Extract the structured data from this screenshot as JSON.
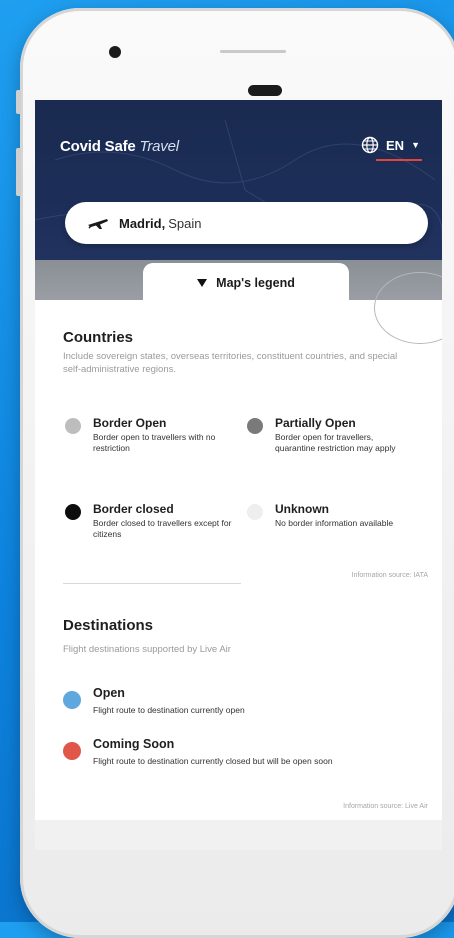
{
  "app": {
    "brand_bold": "Covid Safe",
    "brand_light": "Travel",
    "language": "EN",
    "language_caret": "▼"
  },
  "search": {
    "city": "Madrid,",
    "country": "Spain"
  },
  "legend_tab": {
    "label": "Map's legend"
  },
  "countries": {
    "title": "Countries",
    "description": "Include sovereign states, overseas territories, constituent countries, and special self-administrative regions.",
    "items": [
      {
        "label": "Border Open",
        "desc": "Border open to travellers with no restriction",
        "color": "#bdbdbd"
      },
      {
        "label": "Partially Open",
        "desc": "Border open for travellers, quarantine restriction may apply",
        "color": "#7a7a7a"
      },
      {
        "label": "Border closed",
        "desc": "Border closed to travellers except for citizens",
        "color": "#0d0d0d"
      },
      {
        "label": "Unknown",
        "desc": "No border information available",
        "color": "#eeeeee"
      }
    ],
    "source": "Information source: IATA"
  },
  "destinations": {
    "title": "Destinations",
    "description": "Flight destinations supported by Live Air",
    "items": [
      {
        "label": "Open",
        "desc": "Flight route to destination currently open",
        "color": "#5ea8de"
      },
      {
        "label": "Coming Soon",
        "desc": "Flight route to destination currently closed but will be open soon",
        "color": "#e0574a"
      }
    ],
    "source": "Information source: Live Air"
  },
  "colors": {
    "header": "#1d2f5a",
    "accent": "#e0463f",
    "background": "#1596ea"
  }
}
